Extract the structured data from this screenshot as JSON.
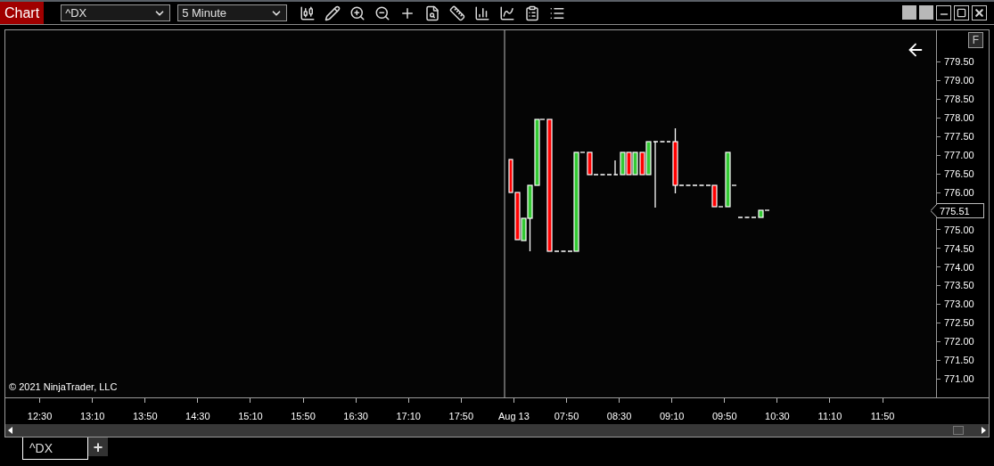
{
  "window": {
    "title": "Chart"
  },
  "toolbar": {
    "instrument": "^DX",
    "interval": "5 Minute"
  },
  "chart": {
    "f_button": "F",
    "current_price": "775.51",
    "copyright": "© 2021 NinjaTrader, LLC",
    "price_labels_above": [
      "779.50",
      "779.00",
      "778.50",
      "778.00",
      "777.50",
      "777.00",
      "776.50",
      "776.00"
    ],
    "price_labels_below": [
      "775.00",
      "774.50",
      "774.00",
      "773.50",
      "773.00",
      "772.50",
      "772.00",
      "771.50",
      "771.00"
    ],
    "time_labels": [
      "12:30",
      "13:10",
      "13:50",
      "14:30",
      "15:10",
      "15:50",
      "16:30",
      "17:10",
      "17:50",
      "Aug 13",
      "07:50",
      "08:30",
      "09:10",
      "09:50",
      "10:30",
      "11:10",
      "11:50"
    ]
  },
  "tabs": [
    {
      "label": "^DX",
      "selected": true
    }
  ],
  "add_tab": "+"
}
